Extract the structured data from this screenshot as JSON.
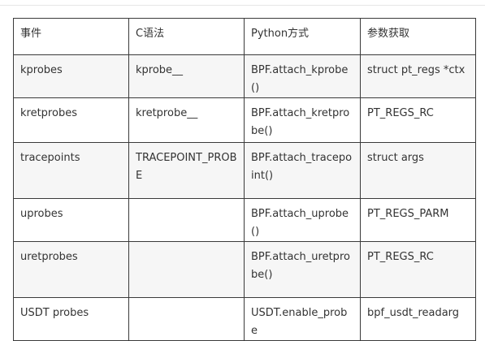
{
  "table": {
    "headers": [
      "事件",
      "C语法",
      "Python方式",
      "参数获取"
    ],
    "rows": [
      [
        "kprobes",
        "kprobe__",
        "BPF.attach_kprobe()",
        "struct pt_regs *ctx"
      ],
      [
        "kretprobes",
        "kretprobe__",
        "BPF.attach_kretprobe()",
        "PT_REGS_RC"
      ],
      [
        "tracepoints",
        "TRACEPOINT_PROBE",
        "BPF.attach_tracepoint()",
        "struct args"
      ],
      [
        "uprobes",
        "",
        "BPF.attach_uprobe()",
        "PT_REGS_PARM"
      ],
      [
        "uretprobes",
        "",
        "BPF.attach_uretprobe()",
        "PT_REGS_RC"
      ],
      [
        "USDT probes",
        "",
        "USDT.enable_probe",
        "bpf_usdt_readarg"
      ]
    ]
  },
  "colors": {
    "border": "#3a3a3a",
    "stripe": "#f6f6f6",
    "text": "#333333"
  }
}
